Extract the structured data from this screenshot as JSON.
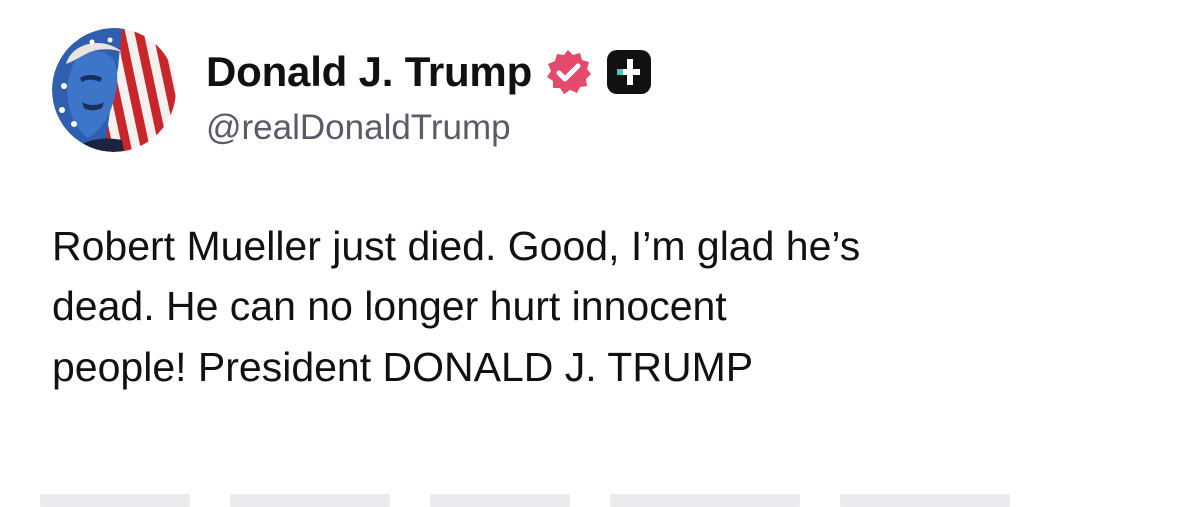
{
  "user": {
    "display_name": "Donald J. Trump",
    "handle": "@realDonaldTrump",
    "verified_icon": "verified-badge-icon",
    "verified_color": "#e44a6b",
    "plus_icon": "plus-badge-icon",
    "avatar_icon": "avatar-flag-portrait"
  },
  "post": {
    "lines": [
      "Robert Mueller just died. Good, I’m glad he’s",
      "dead. He can no longer hurt innocent",
      "people! President DONALD J. TRUMP"
    ]
  },
  "colors": {
    "text": "#111111",
    "handle": "#5b5b66",
    "badge_dark": "#111111"
  }
}
